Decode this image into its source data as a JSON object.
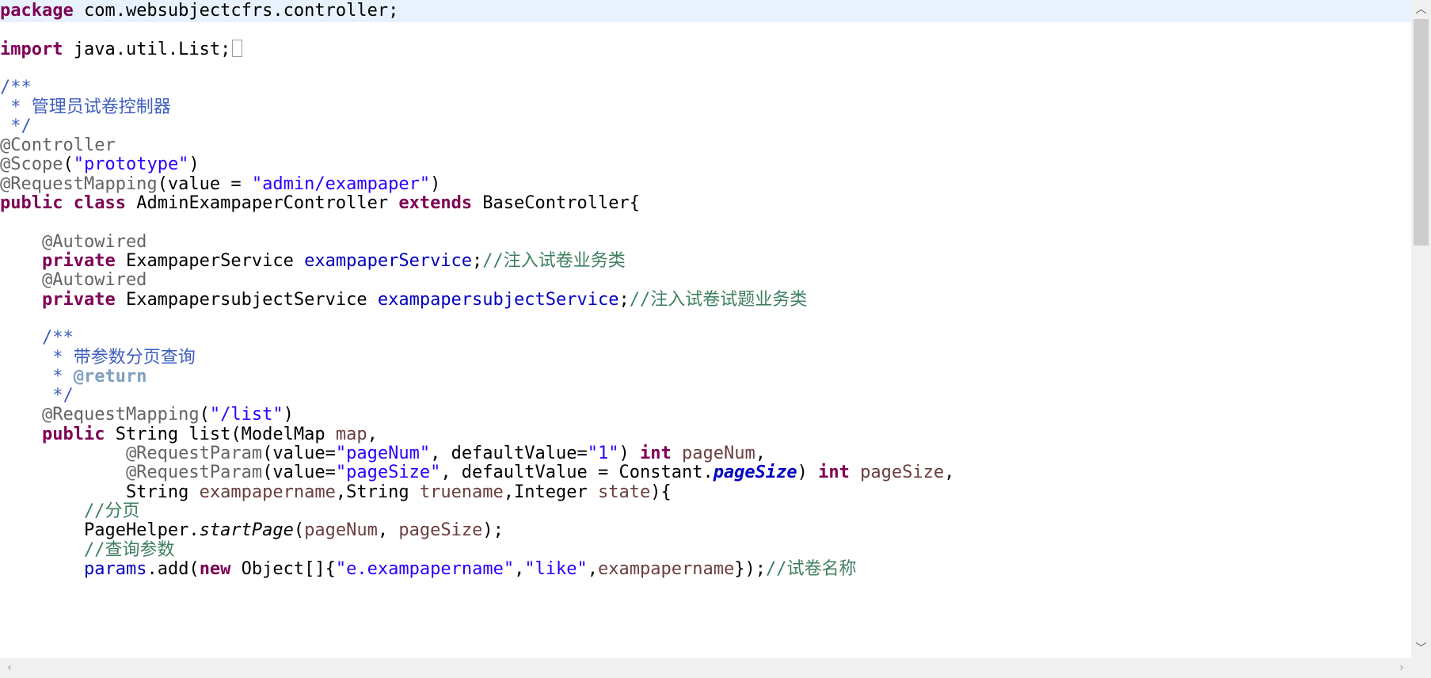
{
  "code": {
    "line1": {
      "kw": "package",
      "rest": " com.websubjectcfrs.controller;"
    },
    "line3": {
      "kw": "import",
      "rest": " java.util.List;"
    },
    "line5": {
      "text": "/**"
    },
    "line6": {
      "text": " * 管理员试卷控制器"
    },
    "line7": {
      "text": " */"
    },
    "line8": {
      "text": "@Controller"
    },
    "line9": {
      "ann": "@Scope",
      "p1": "(",
      "str": "\"prototype\"",
      "p2": ")"
    },
    "line10": {
      "ann": "@RequestMapping",
      "p1": "(value = ",
      "str": "\"admin/exampaper\"",
      "p2": ")"
    },
    "line11": {
      "kw1": "public",
      "kw2": "class",
      "name": " AdminExampaperController ",
      "kw3": "extends",
      "rest": " BaseController{"
    },
    "line13": {
      "text": "    @Autowired"
    },
    "line14": {
      "kw": "    private",
      "type": " ExampaperService ",
      "field": "exampaperService",
      "semi": ";",
      "comment": "//注入试卷业务类"
    },
    "line15": {
      "text": "    @Autowired"
    },
    "line16": {
      "kw": "    private",
      "type": " ExampapersubjectService ",
      "field": "exampapersubjectService",
      "semi": ";",
      "comment": "//注入试卷试题业务类"
    },
    "line18": {
      "text": "    /**"
    },
    "line19": {
      "text": "     * 带参数分页查询"
    },
    "line20": {
      "prefix": "     * ",
      "tag": "@return"
    },
    "line21": {
      "text": "     */"
    },
    "line22": {
      "ann": "    @RequestMapping",
      "p1": "(",
      "str": "\"/list\"",
      "p2": ")"
    },
    "line23": {
      "kw": "    public",
      "t1": " String list(ModelMap ",
      "v1": "map",
      "t2": ","
    },
    "line24": {
      "ann": "            @RequestParam",
      "p1": "(value=",
      "s1": "\"pageNum\"",
      "p2": ", defaultValue=",
      "s2": "\"1\"",
      "p3": ") ",
      "kw": "int",
      "sp": " ",
      "v": "pageNum",
      "end": ","
    },
    "line25": {
      "ann": "            @RequestParam",
      "p1": "(value=",
      "s1": "\"pageSize\"",
      "p2": ", defaultValue = Constant.",
      "sf": "pageSize",
      "p3": ") ",
      "kw": "int",
      "sp": " ",
      "v": "pageSize",
      "end": ","
    },
    "line26": {
      "t1": "            String ",
      "v1": "exampapername",
      "t2": ",String ",
      "v2": "truename",
      "t3": ",Integer ",
      "v3": "state",
      "t4": "){"
    },
    "line27": {
      "text": "        //分页"
    },
    "line28": {
      "t1": "        PageHelper.",
      "m": "startPage",
      "t2": "(",
      "v1": "pageNum",
      "t3": ", ",
      "v2": "pageSize",
      "t4": ");"
    },
    "line29": {
      "text": "        //查询参数"
    },
    "line30": {
      "pre": "        ",
      "v1": "params",
      "t1": ".add(",
      "kw": "new",
      "t2": " Object[]{",
      "s1": "\"e.exampapername\"",
      "t3": ",",
      "s2": "\"like\"",
      "t4": ",",
      "v2": "exampapername",
      "t5": "});",
      "comment": "//试卷名称"
    }
  },
  "scrollbars": {
    "up_arrow": "︿",
    "down_arrow": "﹀",
    "left_arrow": "‹",
    "right_arrow": "›"
  }
}
